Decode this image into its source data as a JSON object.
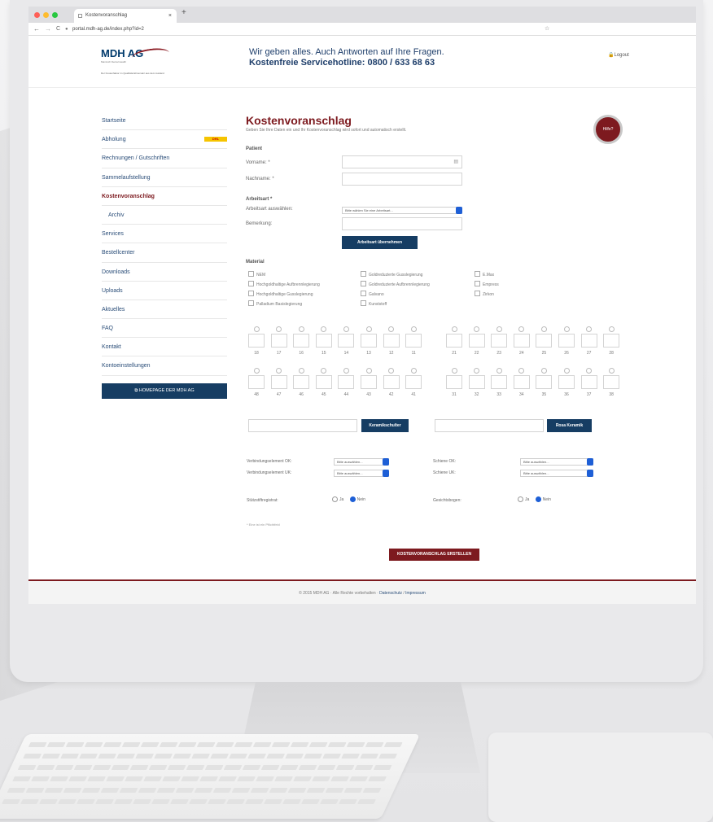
{
  "browser": {
    "tab_title": "Kostenvoranschlag",
    "tab_close": "×",
    "new_tab": "+",
    "url": "portal.mdh-ag.de/index.php?id=2",
    "nav_back": "←",
    "nav_forward": "→",
    "nav_reload": "C"
  },
  "header": {
    "logo_text": "MDH AG",
    "logo_subtitle": "Mamisch Dental Health",
    "logo_tagline": "Der Kostenfaktor im Qualitätszahnersatz aus dem Ausland",
    "slogan": "Wir geben alles. Auch Antworten auf Ihre Fragen.",
    "hotline": "Kostenfreie Servicehotline: 0800 / 633 68 63",
    "logout_label": "Logout"
  },
  "sidebar": {
    "items": [
      {
        "label": "Startseite"
      },
      {
        "label": "Abholung"
      },
      {
        "label": "Rechnungen / Gutschriften"
      },
      {
        "label": "Sammelaufstellung"
      },
      {
        "label": "Kostenvoranschlag"
      },
      {
        "label": "Archiv"
      },
      {
        "label": "Services"
      },
      {
        "label": "Bestellcenter"
      },
      {
        "label": "Downloads"
      },
      {
        "label": "Uploads"
      },
      {
        "label": "Aktuelles"
      },
      {
        "label": "FAQ"
      },
      {
        "label": "Kontakt"
      },
      {
        "label": "Kontoeinstellungen"
      }
    ],
    "dhl_label": "DHL",
    "homepage_button": "HOMEPAGE DER MDH AG"
  },
  "main": {
    "title": "Kostenvoranschlag",
    "intro": "Geben Sie Ihre Daten ein und Ihr Kostenvoranschlag wird sofort und automatisch erstellt.",
    "help_label": "Hilfe?",
    "patient_heading": "Patient",
    "vorname_label": "Vorname: *",
    "nachname_label": "Nachname: *",
    "arbeitsart_heading": "Arbeitsart *",
    "arbeitsart_select_label": "Arbeitsart auswählen:",
    "arbeitsart_select_value": "Bitte wählen Sie eine Arbeitsart...",
    "bemerkung_label": "Bemerkung:",
    "arbeitsart_button": "Arbeitsart übernehmen",
    "material_heading": "Material",
    "materials": [
      "NEM",
      "Hochgoldhaltige Aufbrennlegierung",
      "Hochgoldhaltige Gusslegierung",
      "Palladium Basislegierung",
      "Goldreduzierte Gusslegierung",
      "Goldreduzierte Aufbrennlegierung",
      "Galvano",
      "Kunststoff",
      "E.Max",
      "Empress",
      "Zirkon"
    ],
    "teeth_upper_left": [
      "18",
      "17",
      "16",
      "15",
      "14",
      "13",
      "12",
      "11"
    ],
    "teeth_upper_right": [
      "21",
      "22",
      "23",
      "24",
      "25",
      "26",
      "27",
      "28"
    ],
    "teeth_lower_left": [
      "48",
      "47",
      "46",
      "45",
      "44",
      "43",
      "42",
      "41"
    ],
    "teeth_lower_right": [
      "31",
      "32",
      "33",
      "34",
      "35",
      "36",
      "37",
      "38"
    ],
    "keramikschulter_button": "Keramikschulter",
    "rosa_keramik_button": "Rosa Keramik",
    "verbindung_ok_label": "Verbindungselement OK:",
    "verbindung_uk_label": "Verbindungselement UK:",
    "schiene_ok_label": "Schiene OK:",
    "schiene_uk_label": "Schiene UK:",
    "select_placeholder": "Bitte auswählen...",
    "stuetzstift_label": "Stützstiftregistrat:",
    "gesichtsbogen_label": "Gesichtsbogen:",
    "radio_ja": "Ja",
    "radio_nein": "Nein",
    "required_note": "* Eine ist ein Pflichtfeld",
    "submit_button": "KOSTENVORANSCHLAG ERSTELLEN"
  },
  "footer": {
    "copyright": "© 2015 MDH AG · Alle Rechte vorbehalten ·",
    "datenschutz": "Datenschutz",
    "separator": "/",
    "impressum": "Impressum"
  }
}
